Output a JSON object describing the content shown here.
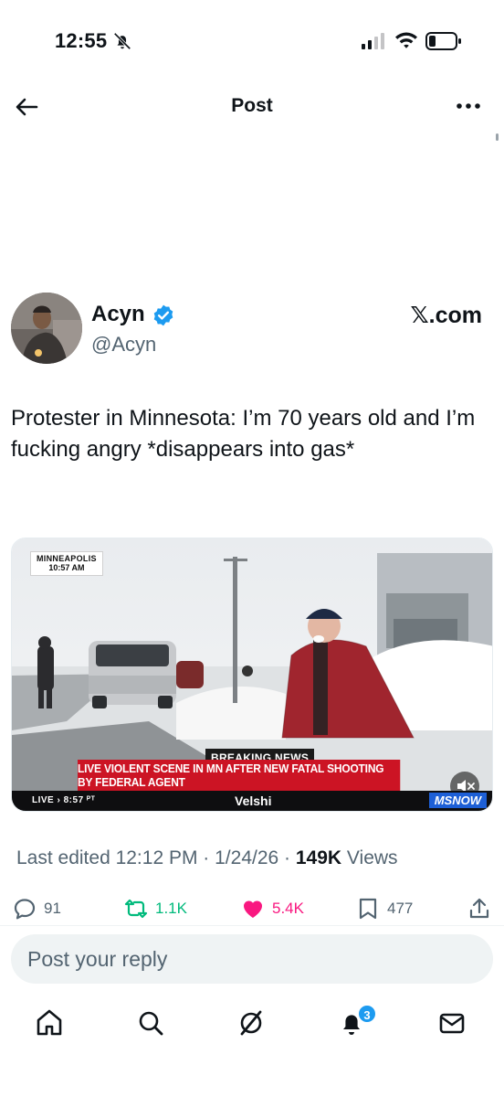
{
  "status_bar": {
    "time": "12:55",
    "bell_icon": "bell-slash-icon",
    "signal_icon": "cellular-signal-icon",
    "wifi_icon": "wifi-icon",
    "battery_icon": "battery-low-icon"
  },
  "header": {
    "title": "Post",
    "back_icon": "arrow-left-icon",
    "more_icon": "more-horizontal-icon"
  },
  "author": {
    "name": "Acyn",
    "handle": "@Acyn",
    "verified": true,
    "source": "𝕏.com"
  },
  "post": {
    "text": "Protester in Minnesota: I’m 70 years old and I’m fucking angry *disappears into gas*"
  },
  "media": {
    "location": "MINNEAPOLIS",
    "location_time": "10:57 AM",
    "breaking_label": "BREAKING NEWS",
    "headline": "LIVE VIOLENT SCENE IN MN AFTER NEW FATAL SHOOTING BY FEDERAL AGENT",
    "live_label": "LIVE  › 8:57 ᴾᵀ",
    "anchor": "Velshi",
    "network": "MSNOW",
    "mute_icon": "speaker-mute-icon"
  },
  "meta": {
    "edited_text": "Last edited 12:12 PM · 1/24/26 · ",
    "views_count": "149K",
    "views_label": " Views"
  },
  "actions": {
    "replies": "91",
    "reposts": "1.1K",
    "likes": "5.4K",
    "bookmarks": "477"
  },
  "reply": {
    "placeholder": "Post your reply"
  },
  "tabbar": {
    "notifications_badge": "3",
    "items": [
      "home-icon",
      "search-icon",
      "grok-icon",
      "notifications-icon",
      "messages-icon"
    ]
  },
  "colors": {
    "accent": "#1d9bf0",
    "repost": "#00ba7c",
    "like": "#f91880",
    "muted": "#536471",
    "breaking_red": "#cc1424"
  }
}
